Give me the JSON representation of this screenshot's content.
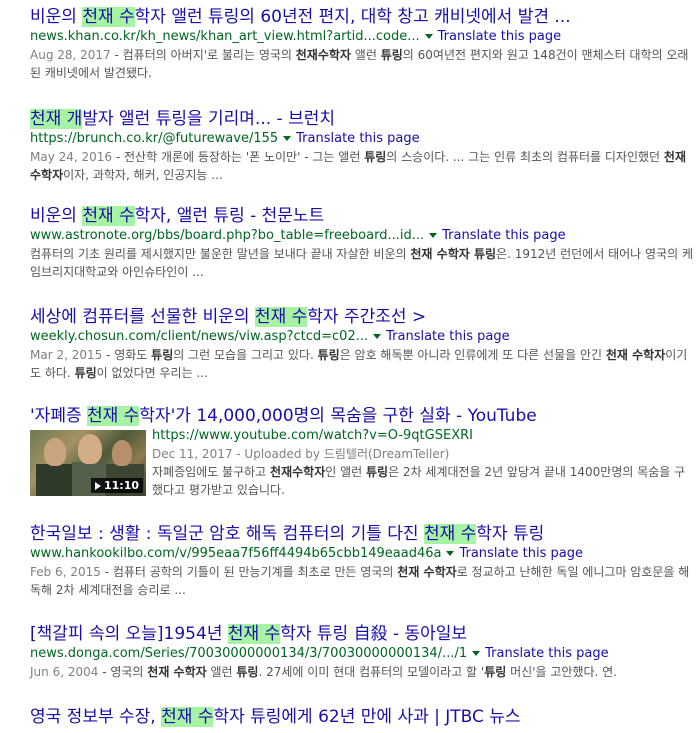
{
  "results": [
    {
      "title_pre": "비운의 ",
      "title_hl": "천재 수",
      "title_post": "학자 앨런 튜링의 60년전 편지, 대학 창고 캐비넷에서 발견 ...",
      "url": "news.khan.co.kr/kh_news/khan_art_view.html?artid...code...",
      "translate": "Translate this page",
      "date": "Aug 28, 2017",
      "snippet_html": " - 컴퓨터의 아버지'로 불리는 영국의 <b>천재수학자</b> 앨런 <b>튜링</b>의 60여년전 편지와 원고 148건이 맨체스터 대학의 오래된 캐비넷에서 발견됐다."
    },
    {
      "title_pre": "",
      "title_hl": "천재 개",
      "title_post": "발자 앨런 튜링을 기리며... - 브런치",
      "url": "https://brunch.co.kr/@futurewave/155",
      "translate": "Translate this page",
      "date": "May 24, 2016",
      "snippet_html": " - 전산학 개론에 등장하는 '폰 노이만' - 그는 앨런 <b>튜링</b>의 스승이다. ... 그는 인류 최초의 컴퓨터를 디자인했던 <b>천재 수학자</b>이자, 과학자, 해커, 인공지능 ..."
    },
    {
      "title_pre": "비운의 ",
      "title_hl": "천재 수",
      "title_post": "학자, 앨런 튜링 - 천문노트",
      "url": "www.astronote.org/bbs/board.php?bo_table=freeboard...id...",
      "translate": "Translate this page",
      "date": "",
      "snippet_html": "컴퓨터의 기초 원리를 제시했지만 불운한 말년을 보내다 끝내 자살한 비운의 <b>천재 수학자 튜링</b>은. 1912년 런던에서 태어나 영국의 케임브리지대학교와 아인슈타인이 ..."
    },
    {
      "title_pre": "세상에 컴퓨터를 선물한 비운의 ",
      "title_hl": "천재 수",
      "title_post": "학자 주간조선 >",
      "url": "weekly.chosun.com/client/news/viw.asp?ctcd=c02...",
      "translate": "Translate this page",
      "date": "Mar 2, 2015",
      "snippet_html": " - 영화도 <b>튜링</b>의 그런 모습을 그리고 있다. <b>튜링</b>은 암호 해독뿐 아니라 인류에게 또 다른 선물을 안긴 <b>천재 수학자</b>이기도 하다. <b>튜링</b>이 없었다면 우리는 ..."
    },
    {
      "title_pre": "'자폐증 ",
      "title_hl": "천재 수",
      "title_post": "학자'가 14,000,000명의 목숨을 구한 실화 - YouTube",
      "url": "https://www.youtube.com/watch?v=O-9qtGSEXRI",
      "translate": "",
      "date": "Dec 11, 2017 - Uploaded by 드림텔러(DreamTeller)",
      "video_duration": "11:10",
      "snippet_html": "자폐증임에도 불구하고 <b>천재수학자</b>인 앨런 <b>튜링</b>은 2차 세계대전을 2년 앞당겨 끝내 1400만명의 목숨을 구했다고 평가받고 있습니다."
    },
    {
      "title_pre": "한국일보 : 생활 : 독일군 암호 해독 컴퓨터의 기틀 다진 ",
      "title_hl": "천재 수",
      "title_post": "학자 튜링",
      "url": "www.hankookilbo.com/v/995eaa7f56ff4494b65cbb149eaad46a",
      "translate": "Translate this page",
      "date": "Feb 6, 2015",
      "snippet_html": " - 컴퓨터 공학의 기틀이 된 만능기계를 최초로 만든 영국의 <b>천재 수학자</b>로 정교하고 난해한 독일 에니그마 암호문을 해독해 2차 세계대전을 승리로 ..."
    },
    {
      "title_pre": "[책갈피 속의 오늘]1954년 ",
      "title_hl": "천재 수",
      "title_post": "학자 튜링 自殺 - 동아일보",
      "url": "news.donga.com/Series/70030000000134/3/70030000000134/.../1",
      "translate": "Translate this page",
      "date": "Jun 6, 2004",
      "snippet_html": " - 영국의 <b>천재 수학자</b> 앨런 <b>튜링</b>. 27세에 이미 현대 컴퓨터의 모델이라고 할 '<b>튜링</b> 머신'을 고안했다. 연."
    },
    {
      "title_pre": "영국 정보부 수장, ",
      "title_hl": "천재 수",
      "title_post": "학자 튜링에게 62년 만에 사과 | JTBC 뉴스",
      "url": "",
      "translate": "",
      "date": "",
      "snippet_html": ""
    }
  ],
  "colors": {
    "link": "#1a0dab",
    "url": "#006621",
    "highlight": "#a6f3a3",
    "snippet": "#545454"
  }
}
